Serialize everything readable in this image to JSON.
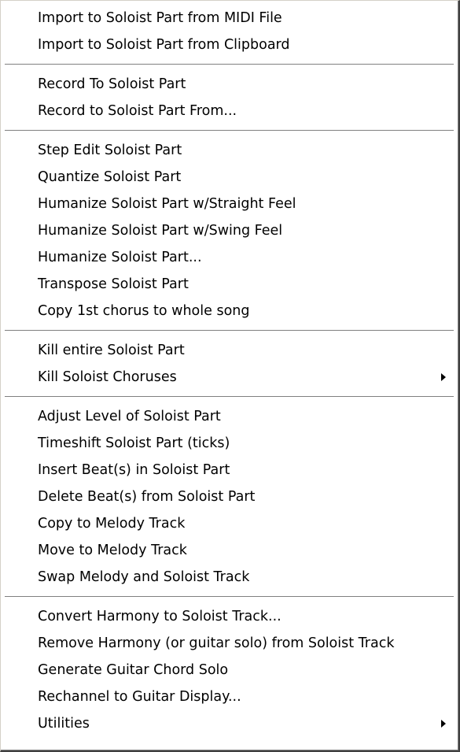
{
  "menu": {
    "groups": [
      {
        "items": [
          {
            "label": "Import to Soloist Part from MIDI File"
          },
          {
            "label": "Import to Soloist Part from Clipboard"
          }
        ]
      },
      {
        "items": [
          {
            "label": "Record To Soloist Part"
          },
          {
            "label": "Record to Soloist Part From..."
          }
        ]
      },
      {
        "items": [
          {
            "label": "Step Edit Soloist Part"
          },
          {
            "label": "Quantize Soloist Part"
          },
          {
            "label": "Humanize Soloist Part w/Straight Feel"
          },
          {
            "label": "Humanize Soloist Part w/Swing Feel"
          },
          {
            "label": "Humanize Soloist Part..."
          },
          {
            "label": "Transpose Soloist Part"
          },
          {
            "label": "Copy 1st chorus to whole song"
          }
        ]
      },
      {
        "items": [
          {
            "label": "Kill entire Soloist Part"
          },
          {
            "label": "Kill Soloist Choruses",
            "submenu": true,
            "icon": "submenu-arrow-icon"
          }
        ]
      },
      {
        "items": [
          {
            "label": "Adjust Level of Soloist Part"
          },
          {
            "label": "Timeshift Soloist Part (ticks)"
          },
          {
            "label": "Insert Beat(s) in Soloist Part"
          },
          {
            "label": "Delete Beat(s) from Soloist Part"
          },
          {
            "label": "Copy to Melody Track"
          },
          {
            "label": "Move to Melody Track"
          },
          {
            "label": "Swap Melody and Soloist Track"
          }
        ]
      },
      {
        "items": [
          {
            "label": "Convert Harmony to Soloist Track..."
          },
          {
            "label": "Remove Harmony (or guitar solo) from Soloist Track"
          },
          {
            "label": "Generate Guitar Chord Solo"
          },
          {
            "label": "Rechannel to Guitar Display..."
          },
          {
            "label": "Utilities",
            "submenu": true,
            "icon": "submenu-arrow-icon"
          }
        ]
      }
    ]
  }
}
